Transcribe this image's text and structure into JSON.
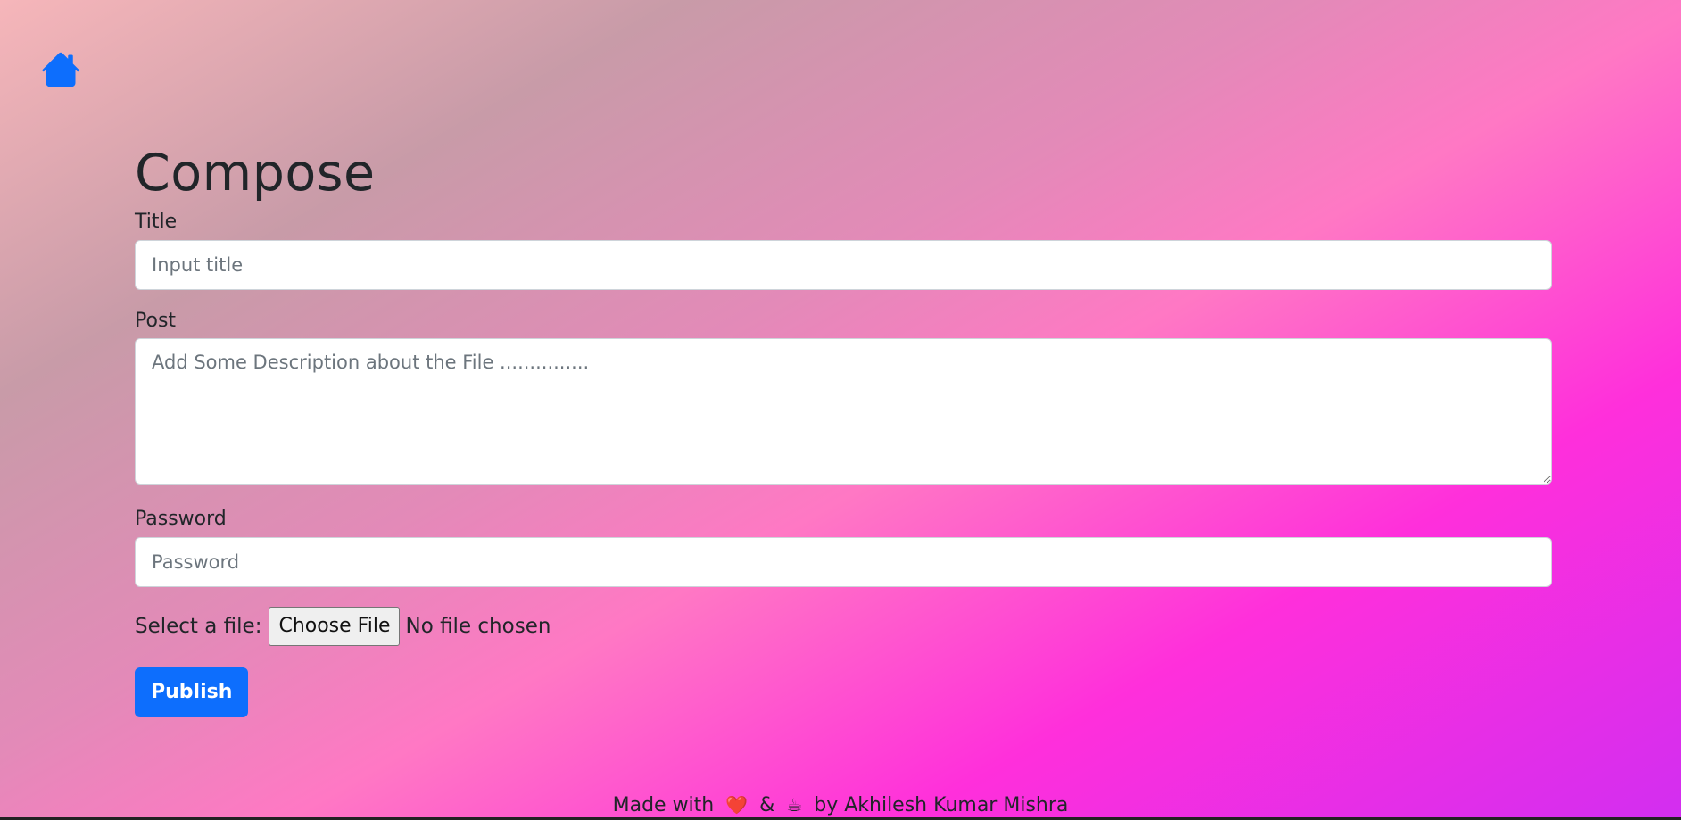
{
  "nav": {
    "home_icon": "home-icon",
    "accent": "#0d6efd"
  },
  "compose": {
    "title": "Compose",
    "title_label": "Title",
    "title_placeholder": "Input title",
    "post_label": "Post",
    "post_placeholder": "Add Some Description about the File ...............",
    "password_label": "Password",
    "password_placeholder": "Password",
    "file_label": "Select a file:",
    "choose_file_label": "Choose File",
    "file_status": "No file chosen",
    "publish_label": "Publish"
  },
  "footer": {
    "made_with": "Made with",
    "heart": "❤️",
    "amp": "&",
    "coffee": "☕",
    "by": "by Akhilesh Kumar Mishra"
  }
}
